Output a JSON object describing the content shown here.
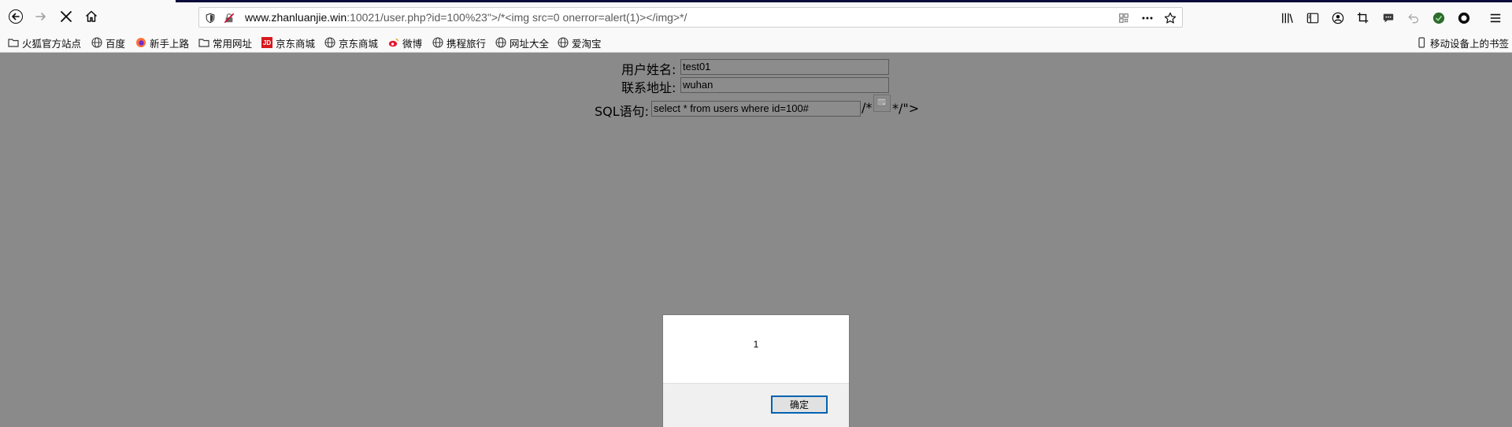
{
  "browser": {
    "url_host": "www.zhanluanjie.win",
    "url_rest": ":10021/user.php?id=100%23\"&gt;/*&lt;img src=0 onerror=alert(1)&gt;&lt;/img&gt;*/",
    "url_display_rest": ":10021/user.php?id=100%23\">/*<img src=0 onerror=alert(1)></img>*/",
    "accent_color": "#0c0c3a"
  },
  "bookmarks": [
    {
      "label": "火狐官方站点",
      "icon": "folder-icon"
    },
    {
      "label": "百度",
      "icon": "globe-icon"
    },
    {
      "label": "新手上路",
      "icon": "firefox-icon"
    },
    {
      "label": "常用网址",
      "icon": "folder-icon"
    },
    {
      "label": "京东商城",
      "icon": "jd-icon"
    },
    {
      "label": "京东商城",
      "icon": "globe-icon"
    },
    {
      "label": "微博",
      "icon": "weibo-icon"
    },
    {
      "label": "携程旅行",
      "icon": "globe-icon"
    },
    {
      "label": "网址大全",
      "icon": "globe-icon"
    },
    {
      "label": "爱淘宝",
      "icon": "globe-icon"
    }
  ],
  "mobile_bookmarks": "移动设备上的书签",
  "form": {
    "username_label": "用户姓名:",
    "username_value": "test01",
    "address_label": "联系地址:",
    "address_value": "wuhan",
    "sql_label": "SQL语句:",
    "sql_value": "select * from users where id=100#",
    "sql_suffix_before": "/*",
    "sql_suffix_after": "*/\">"
  },
  "alert": {
    "message": "1",
    "ok_label": "确定"
  }
}
